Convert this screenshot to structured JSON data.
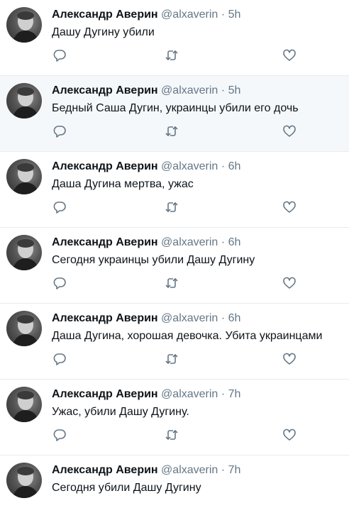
{
  "tweets": [
    {
      "name": "Александр Аверин",
      "handle": "@alxaverin",
      "separator": "·",
      "time": "5h",
      "text": "Дашу Дугину убили",
      "highlighted": false
    },
    {
      "name": "Александр Аверин",
      "handle": "@alxaverin",
      "separator": "·",
      "time": "5h",
      "text": "Бедный Саша Дугин, украинцы убили его дочь",
      "highlighted": true
    },
    {
      "name": "Александр Аверин",
      "handle": "@alxaverin",
      "separator": "·",
      "time": "6h",
      "text": "Даша Дугина мертва, ужас",
      "highlighted": false
    },
    {
      "name": "Александр Аверин",
      "handle": "@alxaverin",
      "separator": "·",
      "time": "6h",
      "text": "Сегодня украинцы убили Дашу Дугину",
      "highlighted": false
    },
    {
      "name": "Александр Аверин",
      "handle": "@alxaverin",
      "separator": "·",
      "time": "6h",
      "text": "Даша Дугина, хорошая девочка. Убита украинцами",
      "highlighted": false
    },
    {
      "name": "Александр Аверин",
      "handle": "@alxaverin",
      "separator": "·",
      "time": "7h",
      "text": "Ужас, убили Дашу Дугину.",
      "highlighted": false
    },
    {
      "name": "Александр Аверин",
      "handle": "@alxaverin",
      "separator": "·",
      "time": "7h",
      "text": "Сегодня убили Дашу Дугину",
      "highlighted": false
    }
  ],
  "icons": {
    "reply": "reply-icon",
    "retweet": "retweet-icon",
    "like": "like-icon"
  },
  "colors": {
    "text": "#0f1419",
    "secondary": "#657786",
    "highlight_bg": "#f5f8fa",
    "divider": "#e6ecf0"
  }
}
